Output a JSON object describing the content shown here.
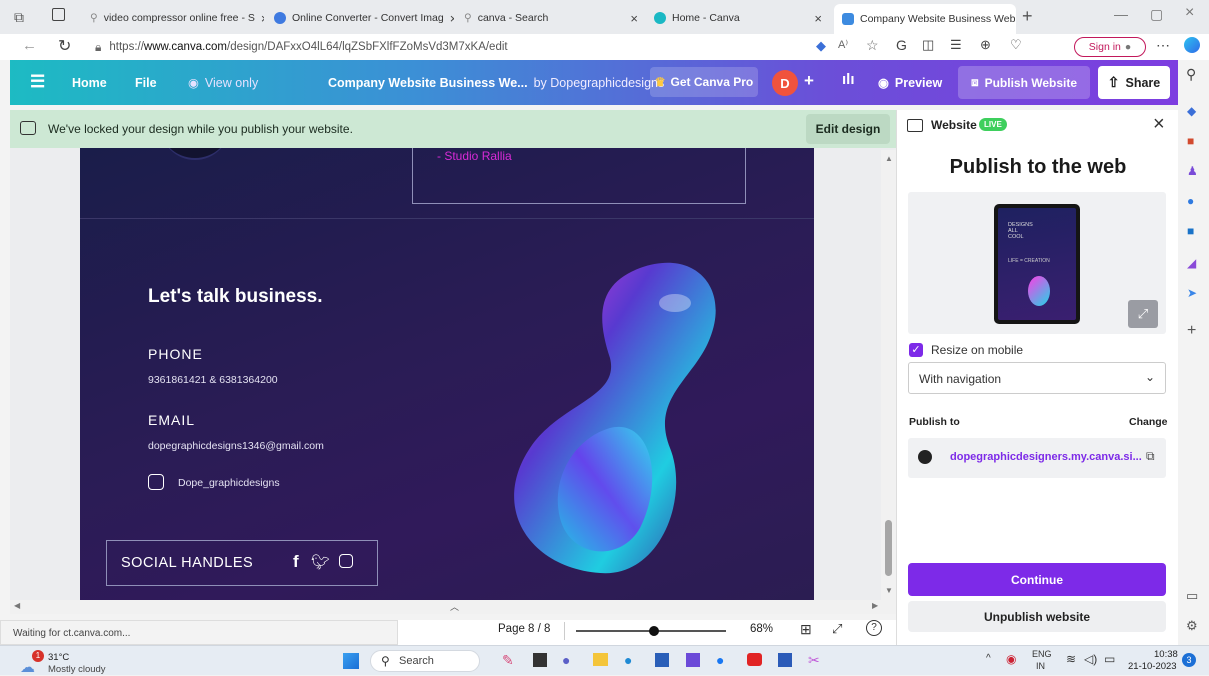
{
  "browser": {
    "tabs": [
      {
        "label": "video compressor online free - S"
      },
      {
        "label": "Online Converter - Convert Imag"
      },
      {
        "label": "canva - Search"
      },
      {
        "label": "Home - Canva"
      },
      {
        "label": "Company Website Business Web"
      }
    ],
    "url_prefix": "https://",
    "url_domain": "www.canva.com",
    "url_path": "/design/DAFxxO4lL64/lqZSbFXlfFZoMsVd3M7xKA/edit",
    "sign_in": "Sign in"
  },
  "topbar": {
    "home": "Home",
    "file": "File",
    "view_only": "View only",
    "title": "Company Website Business We...",
    "author": "by Dopegraphicdesigns",
    "get_pro": "Get Canva Pro",
    "avatar_initial": "D",
    "preview": "Preview",
    "publish": "Publish Website",
    "share": "Share"
  },
  "banner": {
    "message": "We've locked your design while you publish your website.",
    "edit": "Edit design"
  },
  "design": {
    "top_text": "- Studio Rallia",
    "heading": "Let's talk business.",
    "phone_label": "PHONE",
    "phone_value": "9361861421 & 6381364200",
    "email_label": "EMAIL",
    "email_value": "dopegraphicdesigns1346@gmail.com",
    "instagram_handle": "Dope_graphicdesigns",
    "social_label": "SOCIAL HANDLES"
  },
  "panel": {
    "header": "Website",
    "live_badge": "LIVE",
    "title": "Publish to the web",
    "thumb_lines": [
      "DESIGNS",
      "ALL",
      "COOL",
      "LIFE = CREATION"
    ],
    "resize_label": "Resize on mobile",
    "resize_checked": true,
    "nav_select": "With navigation",
    "publish_to_label": "Publish to",
    "change": "Change",
    "site_url": "dopegraphicdesigners.my.canva.si...",
    "continue": "Continue",
    "unpublish": "Unpublish website"
  },
  "statusbar": {
    "loading": "Waiting for ct.canva.com...",
    "page": "Page 8 / 8",
    "zoom": "68%",
    "zoom_level": 0.52
  },
  "taskbar": {
    "weather_temp": "31°C",
    "weather_desc": "Mostly cloudy",
    "weather_badge": "1",
    "search": "Search",
    "lang": "ENG",
    "region": "IN",
    "time": "10:38",
    "date": "21-10-2023",
    "notif": "3"
  },
  "colors": {
    "accent_purple": "#7d2ae8",
    "live_green": "#3ecf5d",
    "banner_green": "#cde8d4",
    "avatar_orange": "#f0533d"
  }
}
